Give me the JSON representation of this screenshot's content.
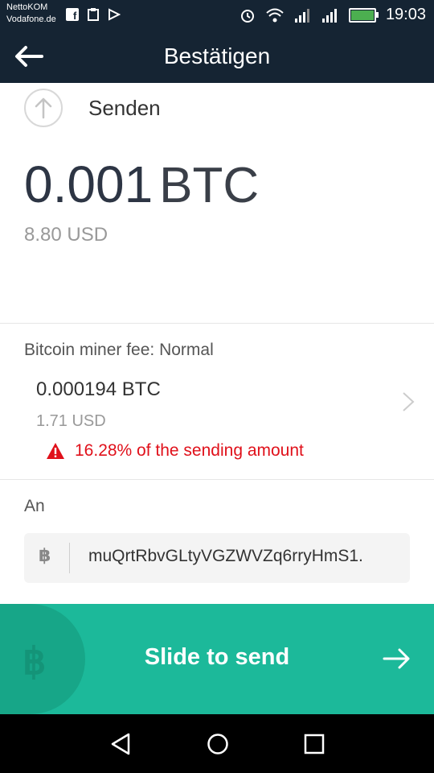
{
  "status_bar": {
    "carrier_line1": "NettoKOM",
    "carrier_line2": "Vodafone.de",
    "time": "19:03",
    "icons": [
      "facebook-icon",
      "clipboard-icon",
      "play-store-icon",
      "alarm-icon",
      "wifi-icon",
      "signal-icon",
      "signal-icon",
      "battery-charging-icon"
    ]
  },
  "app_bar": {
    "title": "Bestätigen",
    "back_icon": "arrow-left-icon"
  },
  "transaction": {
    "type_label": "Senden",
    "amount": "0.001",
    "unit": "BTC",
    "fiat": "8.80 USD"
  },
  "fee": {
    "label": "Bitcoin miner fee: Normal",
    "value": "0.000194 BTC",
    "fiat": "1.71 USD",
    "warning": "16.28% of the sending amount"
  },
  "recipient": {
    "label": "An",
    "address": "muQrtRbvGLtyVGZWVZq6rryHmS1.",
    "symbol": "฿"
  },
  "slider": {
    "label": "Slide to send",
    "knob_symbol": "฿"
  },
  "colors": {
    "header": "#152433",
    "accent": "#1cb99a",
    "warning": "#e0101a"
  }
}
